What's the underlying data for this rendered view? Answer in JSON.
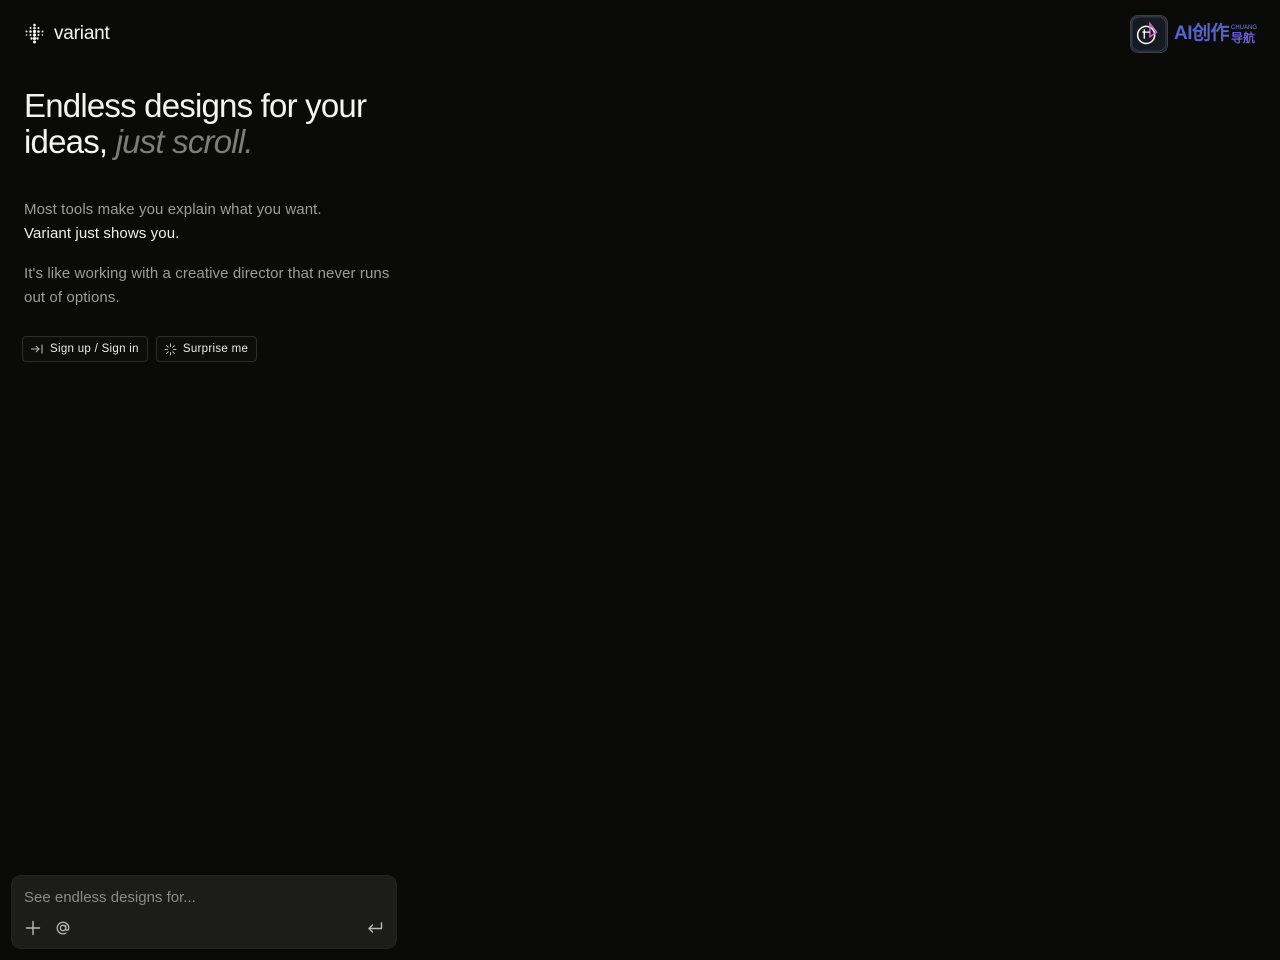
{
  "brand": {
    "name": "variant",
    "icon": "dot-grid-diamond-icon"
  },
  "watermark": {
    "icon": "watermark-logo-icon",
    "main": "AI创作",
    "small": "CHUANG",
    "sub": "导航"
  },
  "hero": {
    "headline": "Endless designs for your ideas,",
    "headline_accent": "just scroll.",
    "para1_line1": "Most tools make you explain what you want.",
    "para1_line2": "Variant just shows you.",
    "para2": "It's like working with a creative director that never runs out of options."
  },
  "actions": {
    "signin_label": "Sign up / Sign in",
    "signin_icon": "sign-in-arrow-icon",
    "surprise_label": "Surprise me",
    "surprise_icon": "sparkle-icon"
  },
  "composer": {
    "placeholder": "See endless designs for...",
    "value": "",
    "add_icon": "plus-icon",
    "mention_icon": "at-icon",
    "submit_icon": "enter-return-icon"
  },
  "colors": {
    "background": "#0a0a09",
    "text_primary": "#f4f4f2",
    "text_muted": "#9c9c98",
    "accent_italic": "#7c7c78",
    "composer_bg": "#1c1c1b"
  }
}
